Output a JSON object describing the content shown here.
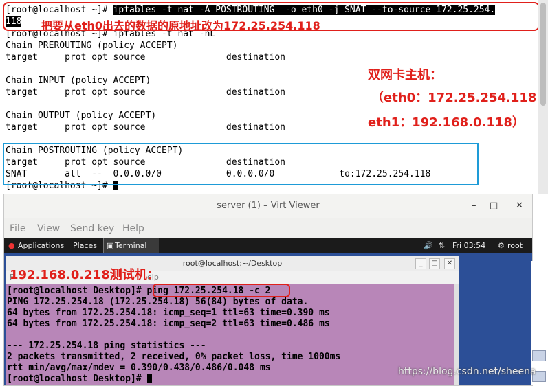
{
  "top_terminal": {
    "line1_prompt": "[root@localhost ~]# ",
    "line1_cmd": "iptables -t nat -A POSTROUTING  -o eth0 -j SNAT --to-source 172.25.254.",
    "line2_wrap": "118",
    "line3": "[root@localhost ~]# iptables -t nat -nL",
    "line4": "Chain PREROUTING (policy ACCEPT)",
    "line5": "target     prot opt source               destination",
    "line7": "Chain INPUT (policy ACCEPT)",
    "line8": "target     prot opt source               destination",
    "line10": "Chain OUTPUT (policy ACCEPT)",
    "line11": "target     prot opt source               destination",
    "line13": "Chain POSTROUTING (policy ACCEPT)",
    "line14": "target     prot opt source               destination",
    "line15": "SNAT       all  --  0.0.0.0/0            0.0.0.0/0            to:172.25.254.118",
    "line16_prompt": "[root@localhost ~]# "
  },
  "annotations": {
    "snat_note": "把要从eth0出去的数据的原地址改为172.25.254.118",
    "host_title": "双网卡主机：",
    "host_eth0": "（eth0：172.25.254.118",
    "host_eth1": "eth1：192.168.0.118）",
    "test_host": "192.168.0.218测试机："
  },
  "viewer": {
    "title": "server (1) – Virt Viewer",
    "minimize": "–",
    "maximize": "□",
    "close": "✕",
    "menu": [
      "File",
      "View",
      "Send key",
      "Help"
    ]
  },
  "gnome_panel": {
    "applications": "Applications",
    "places": "Places",
    "terminal": "Terminal",
    "clock": "Fri 03:54",
    "user": "root"
  },
  "guest_terminal": {
    "title": "root@localhost:~/Desktop",
    "menu_fragment": "F",
    "menu_help": "elp",
    "lines": [
      "[root@localhost Desktop]# ping 172.25.254.18 -c 2",
      "PING 172.25.254.18 (172.25.254.18) 56(84) bytes of data.",
      "64 bytes from 172.25.254.18: icmp_seq=1 ttl=63 time=0.390 ms",
      "64 bytes from 172.25.254.18: icmp_seq=2 ttl=63 time=0.486 ms",
      "",
      "--- 172.25.254.18 ping statistics ---",
      "2 packets transmitted, 2 received, 0% packet loss, time 1000ms",
      "rtt min/avg/max/mdev = 0.390/0.438/0.486/0.048 ms"
    ],
    "last_prompt": "[root@localhost Desktop]# "
  },
  "watermark": "https://blog.csdn.net/sheena",
  "colors": {
    "annotation_red": "#e0201b",
    "annotation_blue": "#1e9bd7",
    "guest_bg": "#b886b8"
  }
}
